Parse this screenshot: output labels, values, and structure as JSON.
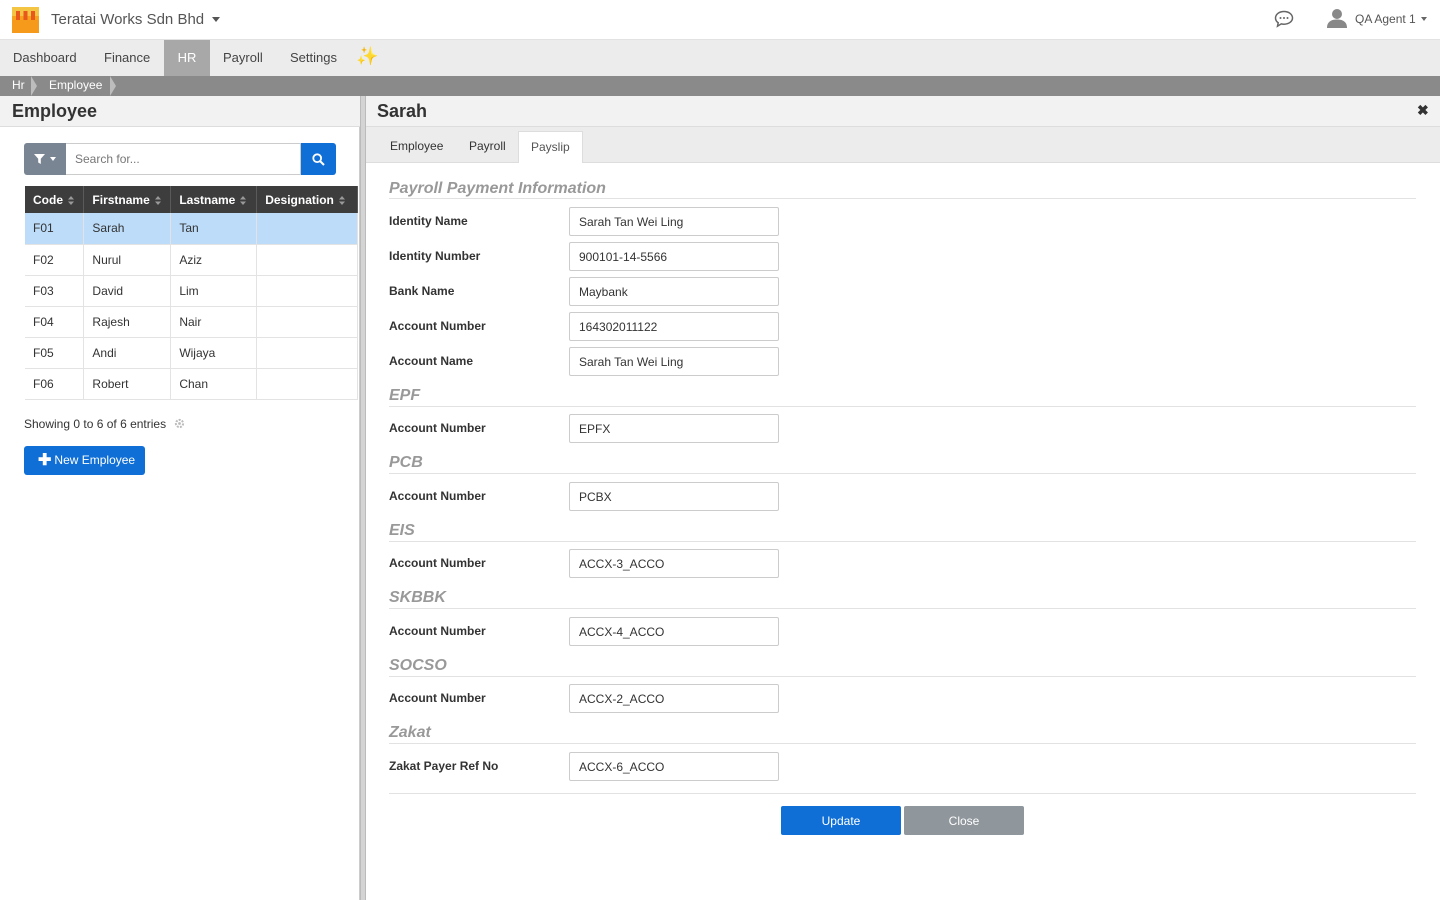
{
  "header": {
    "company": "Teratai Works Sdn Bhd",
    "user": "QA Agent 1"
  },
  "menu": {
    "items": [
      "Dashboard",
      "Finance",
      "HR",
      "Payroll",
      "Settings"
    ],
    "active": "HR"
  },
  "breadcrumb": [
    "Hr",
    "Employee"
  ],
  "left": {
    "title": "Employee",
    "search_placeholder": "Search for...",
    "columns": [
      "Code",
      "Firstname",
      "Lastname",
      "Designation"
    ],
    "rows": [
      {
        "code": "F01",
        "firstname": "Sarah",
        "lastname": "Tan",
        "designation": ""
      },
      {
        "code": "F02",
        "firstname": "Nurul",
        "lastname": "Aziz",
        "designation": ""
      },
      {
        "code": "F03",
        "firstname": "David",
        "lastname": "Lim",
        "designation": ""
      },
      {
        "code": "F04",
        "firstname": "Rajesh",
        "lastname": "Nair",
        "designation": ""
      },
      {
        "code": "F05",
        "firstname": "Andi",
        "lastname": "Wijaya",
        "designation": ""
      },
      {
        "code": "F06",
        "firstname": "Robert",
        "lastname": "Chan",
        "designation": ""
      }
    ],
    "selected_row": 0,
    "showing": "Showing 0 to 6 of 6 entries",
    "new_button": "New Employee"
  },
  "right": {
    "title": "Sarah",
    "tabs": [
      "Employee",
      "Payroll",
      "Payslip"
    ],
    "active_tab": "Payslip",
    "sections": {
      "payment": {
        "title": "Payroll Payment Information",
        "identity_name": {
          "label": "Identity Name",
          "value": "Sarah Tan Wei Ling"
        },
        "identity_number": {
          "label": "Identity Number",
          "value": "900101-14-5566"
        },
        "bank_name": {
          "label": "Bank Name",
          "value": "Maybank"
        },
        "account_number": {
          "label": "Account Number",
          "value": "164302011122"
        },
        "account_name": {
          "label": "Account Name",
          "value": "Sarah Tan Wei Ling"
        }
      },
      "epf": {
        "title": "EPF",
        "label": "Account Number",
        "value": "EPFX"
      },
      "pcb": {
        "title": "PCB",
        "label": "Account Number",
        "value": "PCBX"
      },
      "eis": {
        "title": "EIS",
        "label": "Account Number",
        "value": "ACCX-3_ACCO"
      },
      "skbbk": {
        "title": "SKBBK",
        "label": "Account Number",
        "value": "ACCX-4_ACCO"
      },
      "socso": {
        "title": "SOCSO",
        "label": "Account Number",
        "value": "ACCX-2_ACCO"
      },
      "zakat": {
        "title": "Zakat",
        "label": "Zakat Payer Ref No",
        "value": "ACCX-6_ACCO"
      }
    },
    "update_button": "Update",
    "close_button": "Close"
  }
}
